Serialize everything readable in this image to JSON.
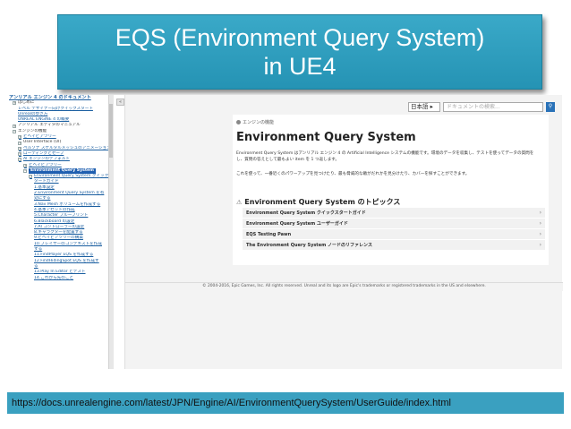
{
  "slide": {
    "title_line1": "EQS (Environment Query System)",
    "title_line2": "in UE4",
    "url": "https://docs.unrealengine.com/latest/JPN/Engine/AI/EnvironmentQuerySystem/UserGuide/index.html",
    "colors": {
      "banner": "#2e9fc0",
      "selected": "#1f5fb0"
    }
  },
  "sidebar": {
    "header": "アンリアル エンジン 4 のドキュメント",
    "collapse_label": "«",
    "items": [
      {
        "label": "はじめに",
        "expand": "+",
        "link": false
      },
      {
        "label": "レベル デザイナー向けクイックスタート",
        "expand": "",
        "link": true
      },
      {
        "label": "Unrealの歩き方",
        "expand": "",
        "link": true
      },
      {
        "label": "UNREAL ENGINE 4 の概要",
        "expand": "",
        "link": true
      },
      {
        "label": "アンリアル エディタのマニュアル",
        "expand": "+",
        "link": false
      },
      {
        "label": "エンジンの機能",
        "expand": "−",
        "link": false
      },
      {
        "label": "ビヘイビアツリー",
        "expand": "+",
        "link": true
      },
      {
        "label": "User Interface (UI)",
        "expand": "+",
        "link": false
      },
      {
        "label": "ペルソナ スケルタルメッシュのアニメーション",
        "expand": "+",
        "link": true
      },
      {
        "label": "ローディングとセーブ",
        "expand": "+",
        "link": true
      },
      {
        "label": "AI エンジンのデフォルト",
        "expand": "−",
        "link": true
      },
      {
        "label": "ビヘイビアツリー",
        "expand": "+",
        "link": true
      },
      {
        "label": "Environment Query System",
        "expand": "−",
        "link": false,
        "selected": true
      },
      {
        "label": "Environment Query System クイックス",
        "expand": "−",
        "link": true
      },
      {
        "label": "タートガイド",
        "expand": "",
        "link": true
      },
      {
        "label": "1.基本設定",
        "expand": "",
        "link": true
      },
      {
        "label": "2.Environment Query System を有",
        "expand": "",
        "link": true
      },
      {
        "label": "効にする",
        "expand": "",
        "link": true
      },
      {
        "label": "3.Nav Mesh ボリュームを作成する",
        "expand": "",
        "link": true
      },
      {
        "label": "4.基本アセットの作成",
        "expand": "",
        "link": true
      },
      {
        "label": "5.Character ブループリント",
        "expand": "",
        "link": true
      },
      {
        "label": "6.Blackboard の設定",
        "expand": "",
        "link": true
      },
      {
        "label": "7.AI コントローラーの設定",
        "expand": "",
        "link": true
      },
      {
        "label": "8.キャラクターを配置する",
        "expand": "",
        "link": true
      },
      {
        "label": "9.ビヘイビアツリーの構築",
        "expand": "",
        "link": true
      },
      {
        "label": "10.プレイヤーのコンテキストを作成",
        "expand": "",
        "link": true
      },
      {
        "label": "する",
        "expand": "",
        "link": true
      },
      {
        "label": "11.FindPlayer EQS を作成する",
        "expand": "",
        "link": true
      },
      {
        "label": "12.FindHidingSpot EQS を作成す",
        "expand": "",
        "link": true
      },
      {
        "label": "る",
        "expand": "",
        "link": true
      },
      {
        "label": "13.Play In Editor とテスト",
        "expand": "",
        "link": true
      },
      {
        "label": "14.これから先のこと",
        "expand": "",
        "link": true
      }
    ]
  },
  "header": {
    "language": "日本語 ▸",
    "search_placeholder": "ドキュメントの検索...",
    "search_icon": "search-icon"
  },
  "content": {
    "breadcrumb": "エンジンの機能",
    "title": "Environment Query System",
    "description": "Environment Query System はアンリアル エンジン 4 の Artificial Intelligence システムの機能です。環境のデータを収集し、テストを使ってデータの質問をし、質問の答えとして最もよい item を 1 つ返します。",
    "description2": "これを使って、一番近くのパワーアップを見つけたり、最も脅威的な敵がだれかを見分けたり、カバーを探すことができます。",
    "topics_title": "Environment Query System のトピックス",
    "topics": [
      {
        "label": "Environment Query System クイックスタートガイド",
        "arrow": "›"
      },
      {
        "label": "Environment Query System ユーザーガイド",
        "arrow": "›"
      },
      {
        "label": "EQS Testing Pawn",
        "arrow": "›"
      },
      {
        "label": "The Environment Query System ノードのリファレンス",
        "arrow": "›"
      }
    ]
  },
  "footer": {
    "text": "© 2004-2016, Epic Games, Inc. All rights reserved. Unreal and its logo are Epic's trademarks or registered trademarks in the US and elsewhere."
  }
}
